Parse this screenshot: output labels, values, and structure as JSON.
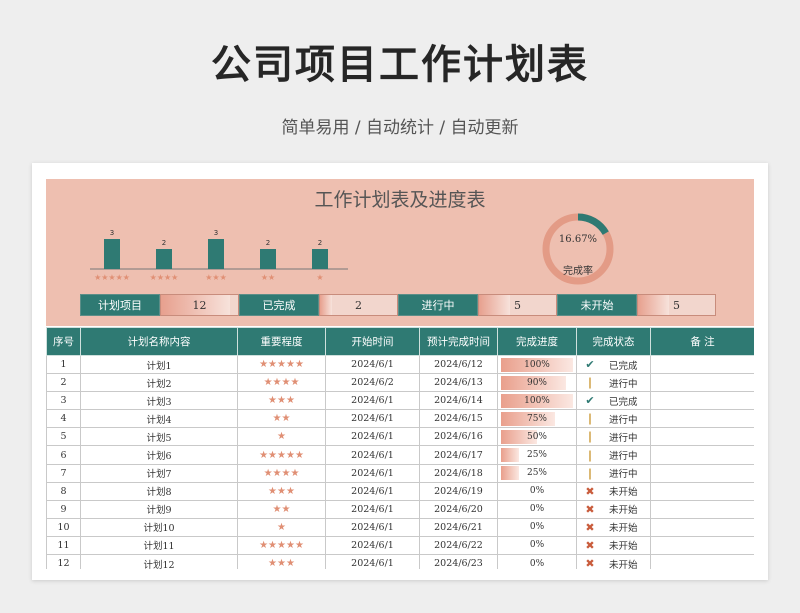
{
  "header": {
    "title": "公司项目工作计划表",
    "subtitle": "简单易用 / 自动统计 / 自动更新"
  },
  "sheet": {
    "title": "工作计划表及进度表",
    "completion_rate": "16.67%",
    "completion_label": "完成率",
    "completion_value": 0.1667,
    "stats": [
      {
        "label": "计划项目",
        "value": "12",
        "fill": 0.9
      },
      {
        "label": "已完成",
        "value": "2",
        "fill": 0.15
      },
      {
        "label": "进行中",
        "value": "5",
        "fill": 0.4
      },
      {
        "label": "未开始",
        "value": "5",
        "fill": 0.4
      }
    ]
  },
  "chart_data": {
    "type": "bar",
    "categories": [
      "★★★★★",
      "★★★★",
      "★★★",
      "★★",
      "★"
    ],
    "values": [
      3,
      2,
      3,
      2,
      2
    ],
    "ylim": [
      0,
      3
    ]
  },
  "colors": {
    "teal": "#2f7a73",
    "salmon": "#eebfb0",
    "star": "#e08f74"
  },
  "table": {
    "headers": [
      "序号",
      "计划名称内容",
      "重要程度",
      "开始时间",
      "预计完成时间",
      "完成进度",
      "完成状态",
      "备 注"
    ],
    "rows": [
      {
        "no": "1",
        "name": "计划1",
        "stars": "★★★★★",
        "start": "2024/6/1",
        "end": "2024/6/12",
        "progress": "100%",
        "p": 1.0,
        "status_icon": "check-icon",
        "status": "已完成"
      },
      {
        "no": "2",
        "name": "计划2",
        "stars": "★★★★",
        "start": "2024/6/2",
        "end": "2024/6/13",
        "progress": "90%",
        "p": 0.9,
        "status_icon": "exclamation-icon",
        "status": "进行中"
      },
      {
        "no": "3",
        "name": "计划3",
        "stars": "★★★",
        "start": "2024/6/1",
        "end": "2024/6/14",
        "progress": "100%",
        "p": 1.0,
        "status_icon": "check-icon",
        "status": "已完成"
      },
      {
        "no": "4",
        "name": "计划4",
        "stars": "★★",
        "start": "2024/6/1",
        "end": "2024/6/15",
        "progress": "75%",
        "p": 0.75,
        "status_icon": "exclamation-icon",
        "status": "进行中"
      },
      {
        "no": "5",
        "name": "计划5",
        "stars": "★",
        "start": "2024/6/1",
        "end": "2024/6/16",
        "progress": "50%",
        "p": 0.5,
        "status_icon": "exclamation-icon",
        "status": "进行中"
      },
      {
        "no": "6",
        "name": "计划6",
        "stars": "★★★★★",
        "start": "2024/6/1",
        "end": "2024/6/17",
        "progress": "25%",
        "p": 0.25,
        "status_icon": "exclamation-icon",
        "status": "进行中"
      },
      {
        "no": "7",
        "name": "计划7",
        "stars": "★★★★",
        "start": "2024/6/1",
        "end": "2024/6/18",
        "progress": "25%",
        "p": 0.25,
        "status_icon": "exclamation-icon",
        "status": "进行中"
      },
      {
        "no": "8",
        "name": "计划8",
        "stars": "★★★",
        "start": "2024/6/1",
        "end": "2024/6/19",
        "progress": "0%",
        "p": 0,
        "status_icon": "cross-icon",
        "status": "未开始"
      },
      {
        "no": "9",
        "name": "计划9",
        "stars": "★★",
        "start": "2024/6/1",
        "end": "2024/6/20",
        "progress": "0%",
        "p": 0,
        "status_icon": "cross-icon",
        "status": "未开始"
      },
      {
        "no": "10",
        "name": "计划10",
        "stars": "★",
        "start": "2024/6/1",
        "end": "2024/6/21",
        "progress": "0%",
        "p": 0,
        "status_icon": "cross-icon",
        "status": "未开始"
      },
      {
        "no": "11",
        "name": "计划11",
        "stars": "★★★★★",
        "start": "2024/6/1",
        "end": "2024/6/22",
        "progress": "0%",
        "p": 0,
        "status_icon": "cross-icon",
        "status": "未开始"
      },
      {
        "no": "12",
        "name": "计划12",
        "stars": "★★★",
        "start": "2024/6/1",
        "end": "2024/6/23",
        "progress": "0%",
        "p": 0,
        "status_icon": "cross-icon",
        "status": "未开始"
      }
    ]
  }
}
